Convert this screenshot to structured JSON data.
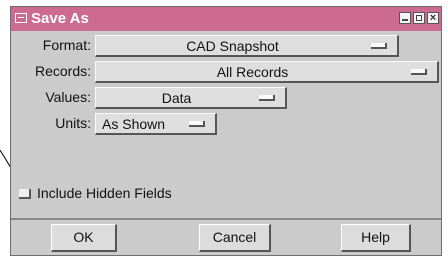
{
  "window": {
    "title": "Save As"
  },
  "form": {
    "format_label": "Format:",
    "format_value": "CAD Snapshot",
    "records_label": "Records:",
    "records_value": "All Records",
    "values_label": "Values:",
    "values_value": "Data",
    "units_label": "Units:",
    "units_value": "As Shown",
    "include_hidden_label": "Include Hidden Fields",
    "include_hidden_checked": false
  },
  "buttons": {
    "ok": "OK",
    "cancel": "Cancel",
    "help": "Help"
  },
  "colors": {
    "titlebar": "#cc6a90",
    "window_bg": "#cbcbcb"
  }
}
